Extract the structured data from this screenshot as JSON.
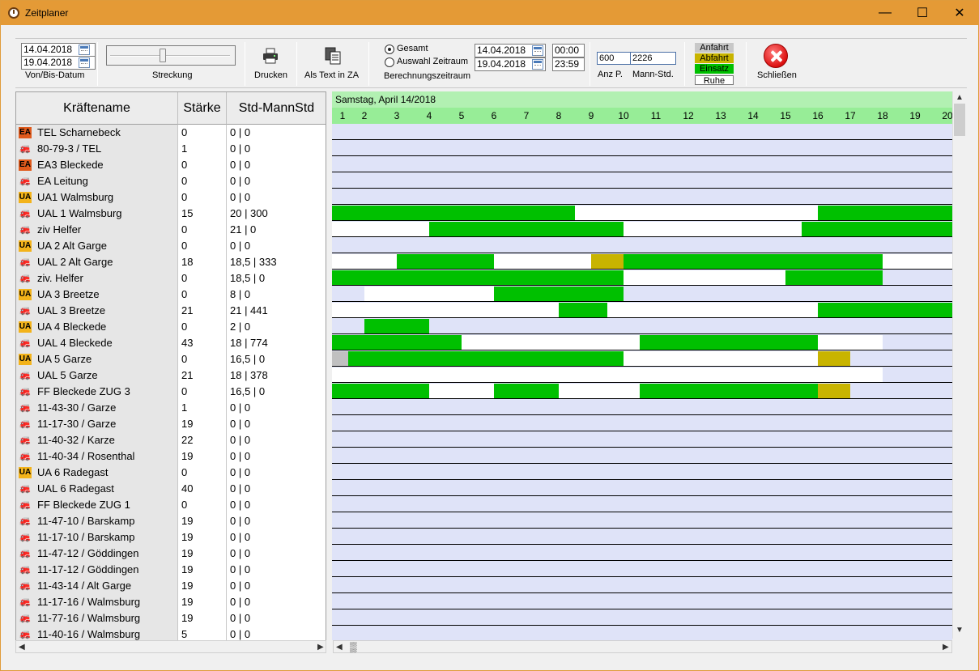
{
  "window": {
    "title": "Zeitplaner",
    "minimize": "—",
    "maximize": "☐",
    "close": "✕"
  },
  "toolbar": {
    "date_from": "14.04.2018",
    "date_to": "19.04.2018",
    "date_label": "Von/Bis-Datum",
    "stretch_label": "Streckung",
    "print_label": "Drucken",
    "text_label": "Als Text in ZA",
    "radio_all": "Gesamt",
    "radio_range": "Auswahl Zeitraum",
    "calc_label": "Berechnungszeitraum",
    "calc_from": "14.04.2018",
    "calc_to": "19.04.2018",
    "time_from": "00:00",
    "time_to": "23:59",
    "anz_value": "600",
    "mann_value": "2226",
    "anz_label": "Anz P.",
    "mann_label": "Mann-Std.",
    "legend": [
      {
        "label": "Anfahrt",
        "color": "#c8c8c8"
      },
      {
        "label": "Abfahrt",
        "color": "#c8b400"
      },
      {
        "label": "Einsatz",
        "color": "#00c000"
      },
      {
        "label": "Ruhe",
        "color": "#ffffff"
      }
    ],
    "close_label": "Schließen"
  },
  "grid": {
    "headers": [
      "Kräftename",
      "Stärke",
      "Std-MannStd"
    ],
    "rows": [
      {
        "icon": "EA",
        "name": "TEL Scharnebeck",
        "strength": "0",
        "hours": "0 | 0"
      },
      {
        "icon": "vehicle",
        "name": "80-79-3 / TEL",
        "strength": "1",
        "hours": "0 | 0"
      },
      {
        "icon": "EA",
        "name": "EA3 Bleckede",
        "strength": "0",
        "hours": "0 | 0"
      },
      {
        "icon": "vehicle",
        "name": "EA Leitung",
        "strength": "0",
        "hours": "0 | 0"
      },
      {
        "icon": "UA",
        "name": "UA1 Walmsburg",
        "strength": "0",
        "hours": "0 | 0"
      },
      {
        "icon": "vehicle",
        "name": "UAL 1 Walmsburg",
        "strength": "15",
        "hours": "20 | 300"
      },
      {
        "icon": "vehicle",
        "name": "ziv Helfer",
        "strength": "0",
        "hours": "21 | 0"
      },
      {
        "icon": "UA",
        "name": "UA 2 Alt Garge",
        "strength": "0",
        "hours": "0 | 0"
      },
      {
        "icon": "vehicle",
        "name": "UAL 2 Alt Garge",
        "strength": "18",
        "hours": "18,5 | 333"
      },
      {
        "icon": "vehicle",
        "name": "ziv. Helfer",
        "strength": "0",
        "hours": "18,5 | 0"
      },
      {
        "icon": "UA",
        "name": "UA 3 Breetze",
        "strength": "0",
        "hours": "8 | 0"
      },
      {
        "icon": "vehicle",
        "name": "UAL 3 Breetze",
        "strength": "21",
        "hours": "21 | 441"
      },
      {
        "icon": "UA",
        "name": "UA 4 Bleckede",
        "strength": "0",
        "hours": "2 | 0"
      },
      {
        "icon": "vehicle",
        "name": "UAL 4 Bleckede",
        "strength": "43",
        "hours": "18 | 774"
      },
      {
        "icon": "UA",
        "name": "UA 5 Garze",
        "strength": "0",
        "hours": "16,5 | 0"
      },
      {
        "icon": "vehicle",
        "name": "UAL 5 Garze",
        "strength": "21",
        "hours": "18 | 378"
      },
      {
        "icon": "vehicle",
        "name": "FF Bleckede ZUG 3",
        "strength": "0",
        "hours": "16,5 | 0"
      },
      {
        "icon": "vehicle",
        "name": "11-43-30 / Garze",
        "strength": "1",
        "hours": "0 | 0"
      },
      {
        "icon": "vehicle",
        "name": "11-17-30 / Garze",
        "strength": "19",
        "hours": "0 | 0"
      },
      {
        "icon": "vehicle",
        "name": "11-40-32 / Karze",
        "strength": "22",
        "hours": "0 | 0"
      },
      {
        "icon": "vehicle",
        "name": "11-40-34 / Rosenthal",
        "strength": "19",
        "hours": "0 | 0"
      },
      {
        "icon": "UA",
        "name": "UA 6 Radegast",
        "strength": "0",
        "hours": "0 | 0"
      },
      {
        "icon": "vehicle",
        "name": "UAL 6 Radegast",
        "strength": "40",
        "hours": "0 | 0"
      },
      {
        "icon": "vehicle",
        "name": "FF Bleckede ZUG 1",
        "strength": "0",
        "hours": "0 | 0"
      },
      {
        "icon": "vehicle",
        "name": "11-47-10 / Barskamp",
        "strength": "19",
        "hours": "0 | 0"
      },
      {
        "icon": "vehicle",
        "name": "11-17-10 / Barskamp",
        "strength": "19",
        "hours": "0 | 0"
      },
      {
        "icon": "vehicle",
        "name": "11-47-12 / Göddingen",
        "strength": "19",
        "hours": "0 | 0"
      },
      {
        "icon": "vehicle",
        "name": "11-17-12 / Göddingen",
        "strength": "19",
        "hours": "0 | 0"
      },
      {
        "icon": "vehicle",
        "name": "11-43-14 / Alt Garge",
        "strength": "19",
        "hours": "0 | 0"
      },
      {
        "icon": "vehicle",
        "name": "11-17-16 / Walmsburg",
        "strength": "19",
        "hours": "0 | 0"
      },
      {
        "icon": "vehicle",
        "name": "11-77-16 / Walmsburg",
        "strength": "19",
        "hours": "0 | 0"
      },
      {
        "icon": "vehicle",
        "name": "11-40-16 / Walmsburg",
        "strength": "5",
        "hours": "0 | 0"
      }
    ]
  },
  "timeline": {
    "date_title": "Samstag,  April 14/2018",
    "hours": [
      "1",
      "2",
      "3",
      "4",
      "5",
      "6",
      "7",
      "8",
      "9",
      "10",
      "11",
      "12",
      "13",
      "14",
      "15",
      "16",
      "17",
      "18",
      "19",
      "20"
    ],
    "colors": {
      "E": "#00c000",
      "R": "#ffffff",
      "A": "#c8b400",
      "G": "#c0c0c0"
    },
    "bars": [
      [],
      [],
      [],
      [],
      [],
      [
        [
          "E",
          1,
          8.5
        ],
        [
          "R",
          8.5,
          16
        ],
        [
          "E",
          16,
          20.2
        ]
      ],
      [
        [
          "R",
          1,
          4
        ],
        [
          "E",
          4,
          10
        ],
        [
          "R",
          10,
          15.5
        ],
        [
          "E",
          15.5,
          20.2
        ]
      ],
      [],
      [
        [
          "R",
          1,
          3
        ],
        [
          "E",
          3,
          6
        ],
        [
          "R",
          6,
          9
        ],
        [
          "A",
          9,
          10
        ],
        [
          "E",
          10,
          18
        ],
        [
          "R",
          18,
          20.2
        ]
      ],
      [
        [
          "E",
          1,
          10
        ],
        [
          "R",
          10,
          15
        ],
        [
          "E",
          15,
          18
        ]
      ],
      [
        [
          "R",
          2,
          6
        ],
        [
          "E",
          6,
          10
        ]
      ],
      [
        [
          "R",
          1,
          8
        ],
        [
          "E",
          8,
          9.5
        ],
        [
          "R",
          9.5,
          16
        ],
        [
          "E",
          16,
          20.2
        ]
      ],
      [
        [
          "E",
          2,
          4
        ]
      ],
      [
        [
          "E",
          1,
          5
        ],
        [
          "R",
          5,
          10.5
        ],
        [
          "E",
          10.5,
          16
        ],
        [
          "R",
          16,
          18
        ]
      ],
      [
        [
          "G",
          1,
          1.5
        ],
        [
          "E",
          1.5,
          10
        ],
        [
          "R",
          10,
          16
        ],
        [
          "A",
          16,
          17
        ]
      ],
      [
        [
          "R",
          1,
          18
        ]
      ],
      [
        [
          "E",
          1,
          4
        ],
        [
          "R",
          4,
          6
        ],
        [
          "E",
          6,
          8
        ],
        [
          "R",
          8,
          10.5
        ],
        [
          "E",
          10.5,
          16
        ],
        [
          "A",
          16,
          17
        ]
      ]
    ]
  }
}
